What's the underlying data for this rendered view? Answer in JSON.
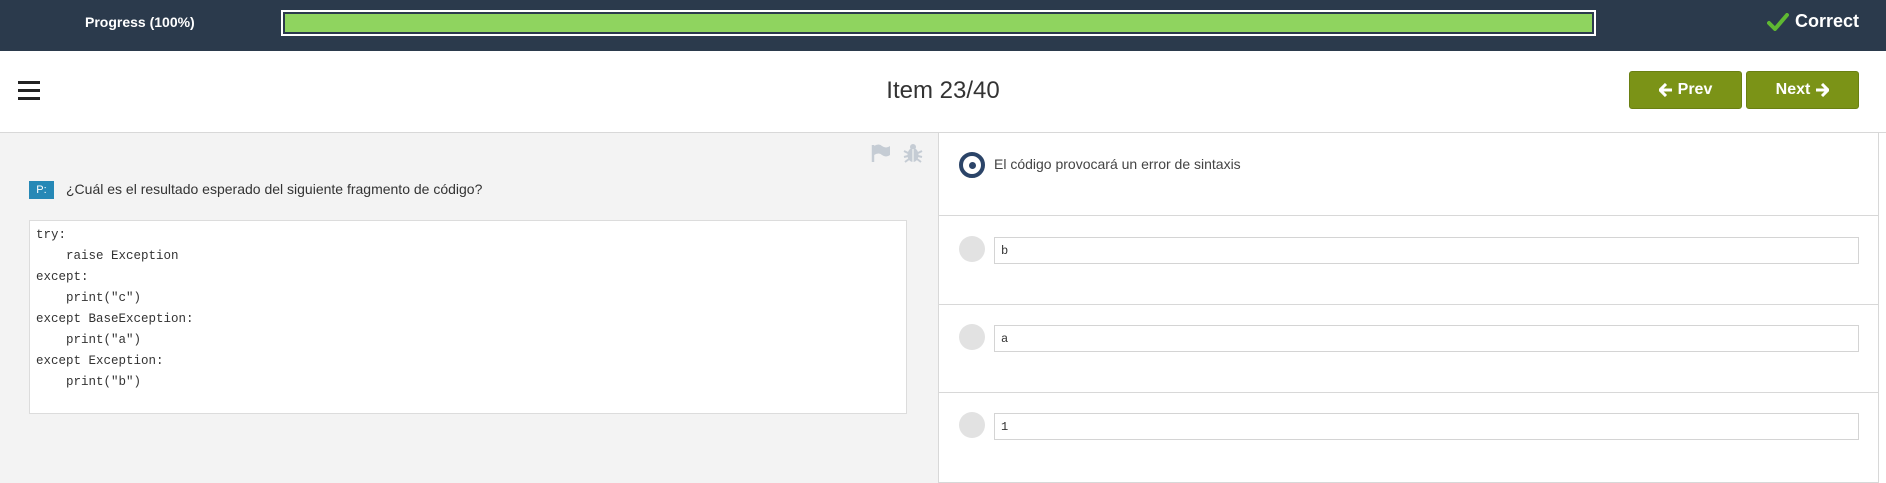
{
  "progress": {
    "label": "Progress (100%)",
    "value_percent": 100,
    "fill_color": "#8fd45f"
  },
  "status": {
    "icon": "check-icon",
    "label": "Correct"
  },
  "header": {
    "menu_icon": "hamburger-menu-icon",
    "title": "Item 23/40",
    "prev_label": "Prev",
    "next_label": "Next",
    "button_color": "#7b9317"
  },
  "question": {
    "badge": "P:",
    "text": "¿Cuál es el resultado esperado del siguiente fragmento de código?",
    "tool_icons": [
      "flag-icon",
      "bug-icon"
    ],
    "code_lines": [
      "try:",
      "    raise Exception",
      "except:",
      "    print(\"c\")",
      "except BaseException:",
      "    print(\"a\")",
      "except Exception:",
      "    print(\"b\")"
    ]
  },
  "answers": {
    "selected_index": 0,
    "options": [
      {
        "text": "El código provocará un error de sintaxis",
        "type": "text"
      },
      {
        "text": "b",
        "type": "code"
      },
      {
        "text": "a",
        "type": "code"
      },
      {
        "text": "1",
        "type": "code"
      }
    ]
  }
}
